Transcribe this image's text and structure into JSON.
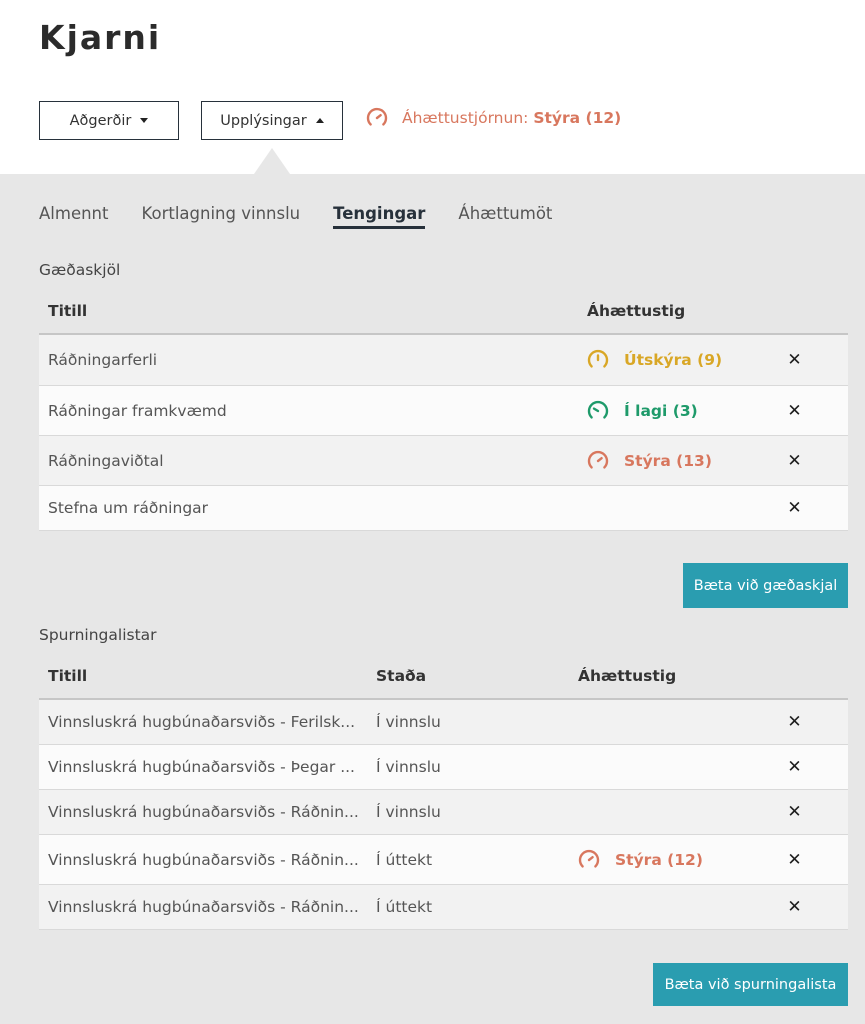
{
  "app": {
    "title": "Kjarni"
  },
  "toolbar": {
    "actions_label": "Aðgerðir",
    "info_label": "Upplýsingar",
    "risk_management_label": "Áhættustjórnun:",
    "risk_management_value": "Stýra (12)"
  },
  "tabs": [
    {
      "label": "Almennt",
      "active": false
    },
    {
      "label": "Kortlagning vinnslu",
      "active": false
    },
    {
      "label": "Tengingar",
      "active": true
    },
    {
      "label": "Áhættumöt",
      "active": false
    }
  ],
  "quality_docs": {
    "title": "Gæðaskjöl",
    "columns": {
      "title": "Titill",
      "risk": "Áhættustig"
    },
    "rows": [
      {
        "title": "Ráðningarferli",
        "risk": "Útskýra (9)",
        "risk_color": "#d9a726"
      },
      {
        "title": "Ráðningar framkvæmd",
        "risk": "Í lagi (3)",
        "risk_color": "#1e9a6a"
      },
      {
        "title": "Ráðningaviðtal",
        "risk": "Stýra (13)",
        "risk_color": "#d8775e"
      },
      {
        "title": "Stefna um ráðningar",
        "risk": "",
        "risk_color": ""
      }
    ],
    "add_button": "Bæta við gæðaskjal"
  },
  "questionnaires": {
    "title": "Spurningalistar",
    "columns": {
      "title": "Titill",
      "status": "Staða",
      "risk": "Áhættustig"
    },
    "rows": [
      {
        "title": "Vinnsluskrá hugbúnaðarsviðs - Ferilsk...",
        "status": "Í vinnslu",
        "risk": "",
        "risk_color": ""
      },
      {
        "title": "Vinnsluskrá hugbúnaðarsviðs - Þegar ...",
        "status": "Í vinnslu",
        "risk": "",
        "risk_color": ""
      },
      {
        "title": "Vinnsluskrá hugbúnaðarsviðs - Ráðnin...",
        "status": "Í vinnslu",
        "risk": "",
        "risk_color": ""
      },
      {
        "title": "Vinnsluskrá hugbúnaðarsviðs - Ráðnin...",
        "status": "Í úttekt",
        "risk": "Stýra (12)",
        "risk_color": "#d8775e"
      },
      {
        "title": "Vinnsluskrá hugbúnaðarsviðs - Ráðnin...",
        "status": "Í úttekt",
        "risk": "",
        "risk_color": ""
      }
    ],
    "add_button": "Bæta við spurningalista"
  },
  "remove_icon": "✕",
  "colors": {
    "accent": "#2a9db0",
    "dark": "#27313b",
    "manage": "#d8775e",
    "explain": "#d9a726",
    "ok": "#1e9a6a"
  }
}
